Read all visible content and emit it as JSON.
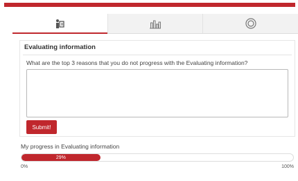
{
  "theme": {
    "accent": "#c0272d"
  },
  "tabs": [
    {
      "icon": "reading-person-icon",
      "active": true
    },
    {
      "icon": "bar-chart-icon",
      "active": false
    },
    {
      "icon": "target-icon",
      "active": false
    }
  ],
  "panel": {
    "title": "Evaluating information",
    "question": "What are the top 3 reasons that you do not progress with the Evaluating information?",
    "answer_value": "",
    "submit_label": "Submit!"
  },
  "progress": {
    "label": "My progress in Evaluating information",
    "value": 0.29,
    "value_text": "29%",
    "min_label": "0%",
    "max_label": "100%"
  }
}
